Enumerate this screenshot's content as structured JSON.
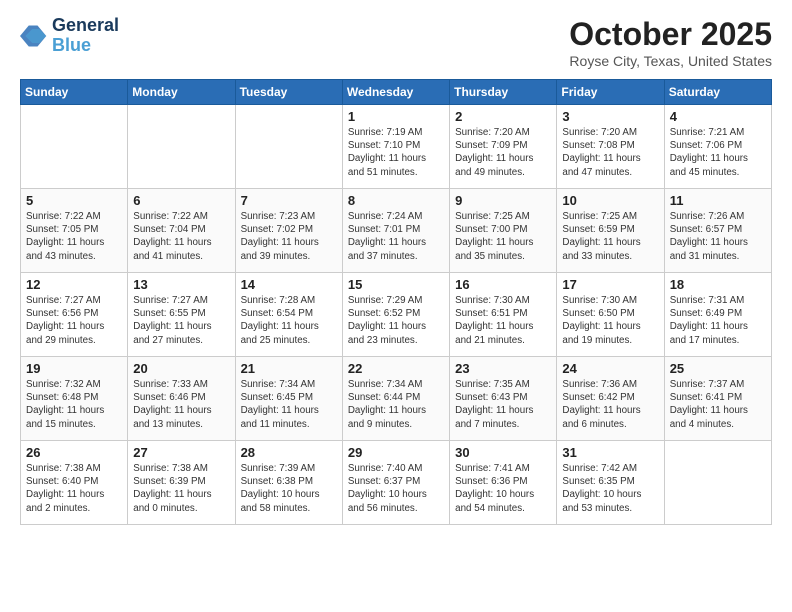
{
  "header": {
    "logo_line1": "General",
    "logo_line2": "Blue",
    "month": "October 2025",
    "location": "Royse City, Texas, United States"
  },
  "days_of_week": [
    "Sunday",
    "Monday",
    "Tuesday",
    "Wednesday",
    "Thursday",
    "Friday",
    "Saturday"
  ],
  "weeks": [
    [
      {
        "day": "",
        "content": ""
      },
      {
        "day": "",
        "content": ""
      },
      {
        "day": "",
        "content": ""
      },
      {
        "day": "1",
        "content": "Sunrise: 7:19 AM\nSunset: 7:10 PM\nDaylight: 11 hours\nand 51 minutes."
      },
      {
        "day": "2",
        "content": "Sunrise: 7:20 AM\nSunset: 7:09 PM\nDaylight: 11 hours\nand 49 minutes."
      },
      {
        "day": "3",
        "content": "Sunrise: 7:20 AM\nSunset: 7:08 PM\nDaylight: 11 hours\nand 47 minutes."
      },
      {
        "day": "4",
        "content": "Sunrise: 7:21 AM\nSunset: 7:06 PM\nDaylight: 11 hours\nand 45 minutes."
      }
    ],
    [
      {
        "day": "5",
        "content": "Sunrise: 7:22 AM\nSunset: 7:05 PM\nDaylight: 11 hours\nand 43 minutes."
      },
      {
        "day": "6",
        "content": "Sunrise: 7:22 AM\nSunset: 7:04 PM\nDaylight: 11 hours\nand 41 minutes."
      },
      {
        "day": "7",
        "content": "Sunrise: 7:23 AM\nSunset: 7:02 PM\nDaylight: 11 hours\nand 39 minutes."
      },
      {
        "day": "8",
        "content": "Sunrise: 7:24 AM\nSunset: 7:01 PM\nDaylight: 11 hours\nand 37 minutes."
      },
      {
        "day": "9",
        "content": "Sunrise: 7:25 AM\nSunset: 7:00 PM\nDaylight: 11 hours\nand 35 minutes."
      },
      {
        "day": "10",
        "content": "Sunrise: 7:25 AM\nSunset: 6:59 PM\nDaylight: 11 hours\nand 33 minutes."
      },
      {
        "day": "11",
        "content": "Sunrise: 7:26 AM\nSunset: 6:57 PM\nDaylight: 11 hours\nand 31 minutes."
      }
    ],
    [
      {
        "day": "12",
        "content": "Sunrise: 7:27 AM\nSunset: 6:56 PM\nDaylight: 11 hours\nand 29 minutes."
      },
      {
        "day": "13",
        "content": "Sunrise: 7:27 AM\nSunset: 6:55 PM\nDaylight: 11 hours\nand 27 minutes."
      },
      {
        "day": "14",
        "content": "Sunrise: 7:28 AM\nSunset: 6:54 PM\nDaylight: 11 hours\nand 25 minutes."
      },
      {
        "day": "15",
        "content": "Sunrise: 7:29 AM\nSunset: 6:52 PM\nDaylight: 11 hours\nand 23 minutes."
      },
      {
        "day": "16",
        "content": "Sunrise: 7:30 AM\nSunset: 6:51 PM\nDaylight: 11 hours\nand 21 minutes."
      },
      {
        "day": "17",
        "content": "Sunrise: 7:30 AM\nSunset: 6:50 PM\nDaylight: 11 hours\nand 19 minutes."
      },
      {
        "day": "18",
        "content": "Sunrise: 7:31 AM\nSunset: 6:49 PM\nDaylight: 11 hours\nand 17 minutes."
      }
    ],
    [
      {
        "day": "19",
        "content": "Sunrise: 7:32 AM\nSunset: 6:48 PM\nDaylight: 11 hours\nand 15 minutes."
      },
      {
        "day": "20",
        "content": "Sunrise: 7:33 AM\nSunset: 6:46 PM\nDaylight: 11 hours\nand 13 minutes."
      },
      {
        "day": "21",
        "content": "Sunrise: 7:34 AM\nSunset: 6:45 PM\nDaylight: 11 hours\nand 11 minutes."
      },
      {
        "day": "22",
        "content": "Sunrise: 7:34 AM\nSunset: 6:44 PM\nDaylight: 11 hours\nand 9 minutes."
      },
      {
        "day": "23",
        "content": "Sunrise: 7:35 AM\nSunset: 6:43 PM\nDaylight: 11 hours\nand 7 minutes."
      },
      {
        "day": "24",
        "content": "Sunrise: 7:36 AM\nSunset: 6:42 PM\nDaylight: 11 hours\nand 6 minutes."
      },
      {
        "day": "25",
        "content": "Sunrise: 7:37 AM\nSunset: 6:41 PM\nDaylight: 11 hours\nand 4 minutes."
      }
    ],
    [
      {
        "day": "26",
        "content": "Sunrise: 7:38 AM\nSunset: 6:40 PM\nDaylight: 11 hours\nand 2 minutes."
      },
      {
        "day": "27",
        "content": "Sunrise: 7:38 AM\nSunset: 6:39 PM\nDaylight: 11 hours\nand 0 minutes."
      },
      {
        "day": "28",
        "content": "Sunrise: 7:39 AM\nSunset: 6:38 PM\nDaylight: 10 hours\nand 58 minutes."
      },
      {
        "day": "29",
        "content": "Sunrise: 7:40 AM\nSunset: 6:37 PM\nDaylight: 10 hours\nand 56 minutes."
      },
      {
        "day": "30",
        "content": "Sunrise: 7:41 AM\nSunset: 6:36 PM\nDaylight: 10 hours\nand 54 minutes."
      },
      {
        "day": "31",
        "content": "Sunrise: 7:42 AM\nSunset: 6:35 PM\nDaylight: 10 hours\nand 53 minutes."
      },
      {
        "day": "",
        "content": ""
      }
    ]
  ]
}
